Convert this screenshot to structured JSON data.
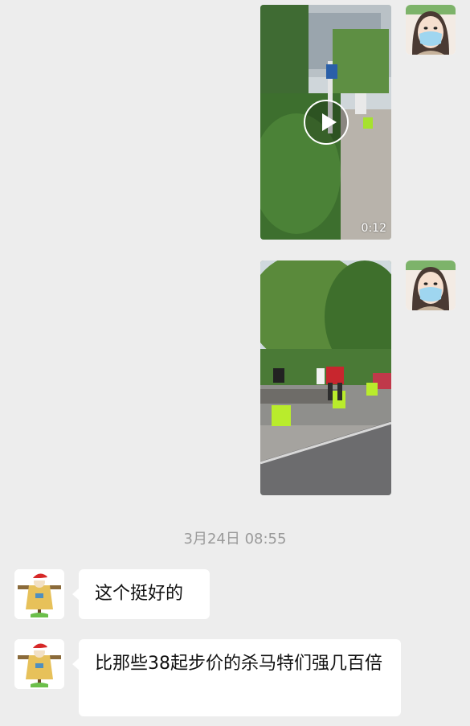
{
  "messages": {
    "video_duration": "0:12",
    "timestamp": "3月24日 08:55",
    "incoming_1": "这个挺好的",
    "incoming_2": "比那些38起步价的杀马特们强几百倍"
  },
  "icons": {
    "self_avatar": "woman-with-mask-avatar",
    "contact_avatar": "scarecrow-santa-hat-avatar",
    "video_play": "play-icon"
  }
}
